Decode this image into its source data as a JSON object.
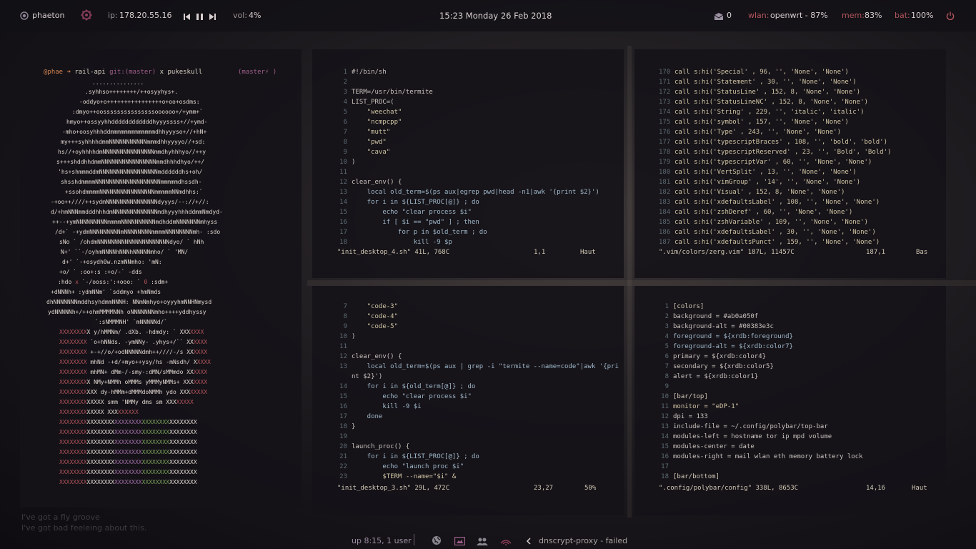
{
  "topbar": {
    "hostname": "phaeton",
    "ip_label": "ip:",
    "ip_value": "178.20.55.16",
    "vol_label": "vol:",
    "vol_value": "4%",
    "datetime": "15:23  Monday 26 Feb 2018",
    "mail_count": "0",
    "wlan_label": "wlan:",
    "wlan_value": "openwrt - 87%",
    "mem_label": "mem:",
    "mem_value": "83%",
    "bat_label": "bat:",
    "bat_value": "100%",
    "icons": [
      "circle-dot-icon",
      "flower-icon",
      "prev-track-icon",
      "pause-icon",
      "next-track-icon",
      "mail-icon",
      "power-icon"
    ],
    "accent_color": "#b1555c"
  },
  "bottombar": {
    "uptime": "up 8:15, 1 user",
    "service": "dnscrypt-proxy - failed",
    "icons": [
      "globe-icon",
      "screen-icon",
      "users-icon",
      "wifi-icon",
      "chevron-left-icon"
    ]
  },
  "background_text": {
    "line1": "I've got a fly groove",
    "line2": "I've got bad feeleing about this."
  },
  "term1": {
    "prompt_user": "@phae",
    "prompt_dir": "rail-api",
    "prompt_git": "git:(master)",
    "prompt_x": "x",
    "prompt_cmd": "pukeskull",
    "right_prompt": "(master⚡ )"
  },
  "term2": {
    "lines": [
      [
        "1",
        "#!/bin/sh"
      ],
      [
        "2",
        ""
      ],
      [
        "3",
        "TERM=/usr/bin/termite"
      ],
      [
        "4",
        "LIST_PROC=("
      ],
      [
        "5",
        "    \"weechat\""
      ],
      [
        "6",
        "    \"ncmpcpp\""
      ],
      [
        "7",
        "    \"mutt\""
      ],
      [
        "8",
        "    \"pwd\""
      ],
      [
        "9",
        "    \"cava\""
      ],
      [
        "10",
        ")"
      ],
      [
        "11",
        ""
      ],
      [
        "12",
        "clear_env() {"
      ],
      [
        "13",
        "    local old_term=$(ps aux|egrep pwd|head -n1|awk '{print $2}')"
      ],
      [
        "14",
        "    for i in ${LIST_PROC[@]} ; do"
      ],
      [
        "15",
        "        echo \"clear process $i\""
      ],
      [
        "16",
        "        if [ $i == \"pwd\" ] ; then"
      ],
      [
        "17",
        "            for p in $old_term ; do"
      ],
      [
        "18",
        "                kill -9 $p"
      ]
    ],
    "status_file": "\"init_desktop_4.sh\" 41L, 768C",
    "status_pos": "1,1",
    "status_scroll": "Haut"
  },
  "term3": {
    "lines": [
      [
        "170",
        "call s:hi('Special' , 96, '', 'None', 'None')"
      ],
      [
        "171",
        "call s:hi('Statement' , 30, '', 'None', 'None')"
      ],
      [
        "172",
        "call s:hi('StatusLine' , 152, 8, 'None', 'None')"
      ],
      [
        "173",
        "call s:hi('StatusLineNC' , 152, 8, 'None', 'None')"
      ],
      [
        "174",
        "call s:hi('String' , 229, '', 'italic', 'italic')"
      ],
      [
        "175",
        "call s:hi('symbol' , 157, '', 'None', 'None')"
      ],
      [
        "176",
        "call s:hi('Type' , 243, '', 'None', 'None')"
      ],
      [
        "177",
        "call s:hi('typescriptBraces' , 108, '', 'bold', 'bold')"
      ],
      [
        "178",
        "call s:hi('typescriptReserved' , 23, '', 'Bold', 'Bold')"
      ],
      [
        "179",
        "call s:hi('typescriptVar' , 60, '', 'None', 'None')"
      ],
      [
        "180",
        "call s:hi('VertSplit' , 13, '', 'None', 'None')"
      ],
      [
        "181",
        "call s:hi('vimGroup' , '14', '', 'None', 'None')"
      ],
      [
        "182",
        "call s:hi('Visual' , 152, 8, 'None', 'None')"
      ],
      [
        "183",
        "call s:hi('xdefaultsLabel' , 108, '', 'None', 'None')"
      ],
      [
        "184",
        "call s:hi('zshDeref' , 60, '', 'None', 'None')"
      ],
      [
        "185",
        "call s:hi('zshVariable' , 109, '', 'None', 'None')"
      ],
      [
        "186",
        "call s:hi('xdefaultsLabel' , 30, '', 'None', 'None')"
      ],
      [
        "187",
        "call s:hi('xdefaultsPunct' , 159, '', 'None', 'None')"
      ]
    ],
    "status_file": "\".vim/colors/zerg.vim\" 187L, 11457C",
    "status_pos": "187,1",
    "status_scroll": "Bas"
  },
  "term4": {
    "lines": [
      [
        "7",
        "    \"code-3\""
      ],
      [
        "8",
        "    \"code-4\""
      ],
      [
        "9",
        "    \"code-5\""
      ],
      [
        "10",
        ")"
      ],
      [
        "11",
        ""
      ],
      [
        "12",
        "clear_env() {"
      ],
      [
        "13",
        "    local old_term=$(ps aux | grep -i \"termite --name=code\"|awk '{pri"
      ],
      [
        "",
        "nt $2}')"
      ],
      [
        "14",
        "    for i in ${old_term[@]} ; do"
      ],
      [
        "15",
        "        echo \"clear process $i\""
      ],
      [
        "16",
        "        kill -9 $i"
      ],
      [
        "17",
        "    done"
      ],
      [
        "18",
        "}"
      ],
      [
        "19",
        ""
      ],
      [
        "20",
        "launch_proc() {"
      ],
      [
        "21",
        "    for i in ${LIST_PROC[@]} ; do"
      ],
      [
        "22",
        "        echo \"launch proc $i\""
      ],
      [
        "23",
        "        $TERM --name=\"$i\" &"
      ]
    ],
    "status_file": "\"init_desktop_3.sh\" 29L, 472C",
    "status_pos": "23,27",
    "status_scroll": "50%"
  },
  "term5": {
    "lines": [
      [
        "1",
        "[colors]"
      ],
      [
        "2",
        "background = #ab0a050f"
      ],
      [
        "3",
        "background-alt = #00383e3c"
      ],
      [
        "4",
        "foreground = ${xrdb:foreground}"
      ],
      [
        "5",
        "foreground-alt = ${xrdb:color7}"
      ],
      [
        "6",
        "primary = ${xrdb:color4}"
      ],
      [
        "7",
        "secondary = ${xrdb:color5}"
      ],
      [
        "8",
        "alert = ${xrdb:color1}"
      ],
      [
        "9",
        ""
      ],
      [
        "10",
        "[bar/top]"
      ],
      [
        "11",
        "monitor = \"eDP-1\""
      ],
      [
        "12",
        "dpi = 133"
      ],
      [
        "13",
        "include-file = ~/.config/polybar/top-bar"
      ],
      [
        "14",
        "modules-left = hostname tor ip mpd volume"
      ],
      [
        "15",
        "modules-center = date"
      ],
      [
        "16",
        "modules-right = mail wlan eth memory battery lock"
      ],
      [
        "17",
        ""
      ],
      [
        "18",
        "[bar/bottom]"
      ]
    ],
    "status_file": "\".config/polybar/config\" 338L, 8653C",
    "status_pos": "14,16",
    "status_scroll": "Haut"
  }
}
